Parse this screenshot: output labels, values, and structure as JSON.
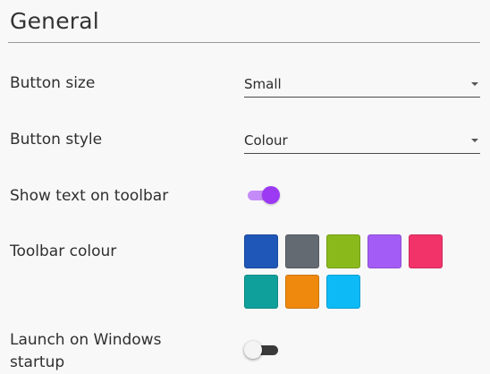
{
  "section": {
    "title": "General"
  },
  "settings": {
    "button_size": {
      "label": "Button size",
      "value": "Small"
    },
    "button_style": {
      "label": "Button style",
      "value": "Colour"
    },
    "show_text": {
      "label": "Show text on toolbar",
      "enabled": true
    },
    "toolbar_colour": {
      "label": "Toolbar colour",
      "swatches": [
        {
          "name": "blue",
          "color": "#1f57b8"
        },
        {
          "name": "grey",
          "color": "#646a72"
        },
        {
          "name": "green",
          "color": "#8ab91c"
        },
        {
          "name": "purple",
          "color": "#a45cf6"
        },
        {
          "name": "pink",
          "color": "#f2336a"
        },
        {
          "name": "teal",
          "color": "#10a09c"
        },
        {
          "name": "orange",
          "color": "#ef890d"
        },
        {
          "name": "light-blue",
          "color": "#0dbaf6"
        }
      ]
    },
    "launch_on_startup": {
      "label_line1": "Launch on Windows",
      "label_line2": "startup",
      "enabled": false
    }
  },
  "colors": {
    "toggle_on_thumb": "#9c39f2",
    "toggle_on_track": "#c58cf7",
    "toggle_off_track": "#3a3a3a"
  }
}
